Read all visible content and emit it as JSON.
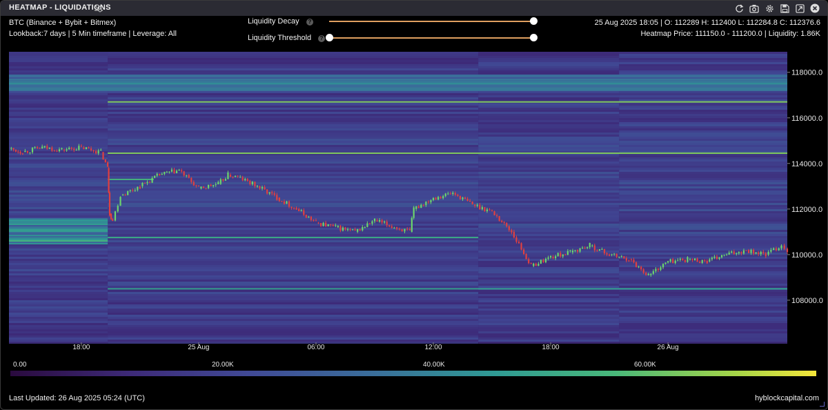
{
  "window": {
    "title": "HEATMAP - LIQUIDATIONS",
    "icons": [
      "refresh-icon",
      "camera-icon",
      "gear-icon",
      "save-icon",
      "expand-icon",
      "close-icon"
    ]
  },
  "info": {
    "line1": "BTC (Binance + Bybit + Bitmex)",
    "line2": "Lookback:7 days | 5 Min timeframe | Leverage: All",
    "ohlc": "25 Aug 2025 18:05 | O: 112289 H: 112400 L: 112284.8 C: 112376.6",
    "heatmap": "Heatmap Price: 111150.0 - 111200.0 | Liquidity: 1.86K"
  },
  "controls": {
    "decay_label": "Liquidity Decay",
    "threshold_label": "Liquidity Threshold",
    "help": "?",
    "decay_value": 1.0,
    "threshold_value": [
      0.0,
      1.0
    ]
  },
  "chart_data": {
    "type": "heatmap",
    "title": "",
    "y_ticks": [
      118000.0,
      116000.0,
      114000.0,
      112000.0,
      110000.0,
      108000.0
    ],
    "y_tick_labels": [
      "118000.0",
      "116000.0",
      "114000.0",
      "112000.0",
      "110000.0",
      "108000.0"
    ],
    "ylim": [
      106150,
      118900
    ],
    "x_ticks": [
      "18:00",
      "25 Aug",
      "06:00",
      "12:00",
      "18:00",
      "26 Aug"
    ],
    "x_tick_hours": [
      0,
      6,
      12,
      18,
      24,
      30
    ],
    "xlim_hours": [
      -3.7,
      36.1
    ],
    "price_series": {
      "hours": [
        -3.7,
        -3,
        -2,
        -1,
        0,
        1,
        1.35,
        1.45,
        1.6,
        2,
        3,
        4,
        5,
        6,
        7,
        7.5,
        8,
        9,
        10,
        11,
        12,
        13,
        14,
        15,
        16,
        16.8,
        17,
        18,
        19,
        20,
        21,
        22,
        23,
        24,
        25,
        26,
        27,
        28,
        29,
        30,
        31,
        32,
        33,
        34,
        35,
        35.8,
        36.1
      ],
      "close": [
        114650,
        114500,
        114700,
        114600,
        114700,
        114500,
        113800,
        111800,
        111500,
        112600,
        113000,
        113500,
        113700,
        112900,
        113100,
        113500,
        113400,
        113000,
        112500,
        112000,
        111400,
        111200,
        111000,
        111500,
        111200,
        111000,
        112000,
        112500,
        112700,
        112200,
        111900,
        111000,
        109500,
        109900,
        110100,
        110400,
        110000,
        109800,
        109100,
        109700,
        109800,
        109700,
        110000,
        110200,
        110000,
        110400,
        110200
      ]
    },
    "colorbar": {
      "ticks": [
        "0.00",
        "20.00K",
        "40.00K",
        "60.00K"
      ],
      "tick_values": [
        0,
        20000,
        40000,
        60000
      ],
      "max": 73000,
      "colors": [
        "#2a0a3e",
        "#3d2a78",
        "#404a96",
        "#3a6e9a",
        "#2f9a94",
        "#49b87a",
        "#a5d548",
        "#f4e63a"
      ]
    },
    "bright_levels": [
      {
        "price": 117500,
        "from_hour": -3.7,
        "to_hour": 36.1,
        "intensity": 0.55
      },
      {
        "price": 116700,
        "from_hour": 1.35,
        "to_hour": 36.1,
        "intensity": 0.8
      },
      {
        "price": 114450,
        "from_hour": 1.35,
        "to_hour": 36.1,
        "intensity": 0.8
      },
      {
        "price": 113300,
        "from_hour": 1.35,
        "to_hour": 3.7,
        "intensity": 0.7
      },
      {
        "price": 110750,
        "from_hour": 1.35,
        "to_hour": 20.3,
        "intensity": 0.65
      },
      {
        "price": 108500,
        "from_hour": 1.35,
        "to_hour": 36.1,
        "intensity": 0.6
      },
      {
        "price": 111200,
        "from_hour": -3.7,
        "to_hour": 1.35,
        "intensity": 0.45
      },
      {
        "price": 110600,
        "from_hour": -3.7,
        "to_hour": 1.35,
        "intensity": 0.7
      }
    ]
  },
  "footer": {
    "updated": "Last Updated: 26 Aug 2025 05:24 (UTC)",
    "brand": "hyblockcapital.com"
  }
}
